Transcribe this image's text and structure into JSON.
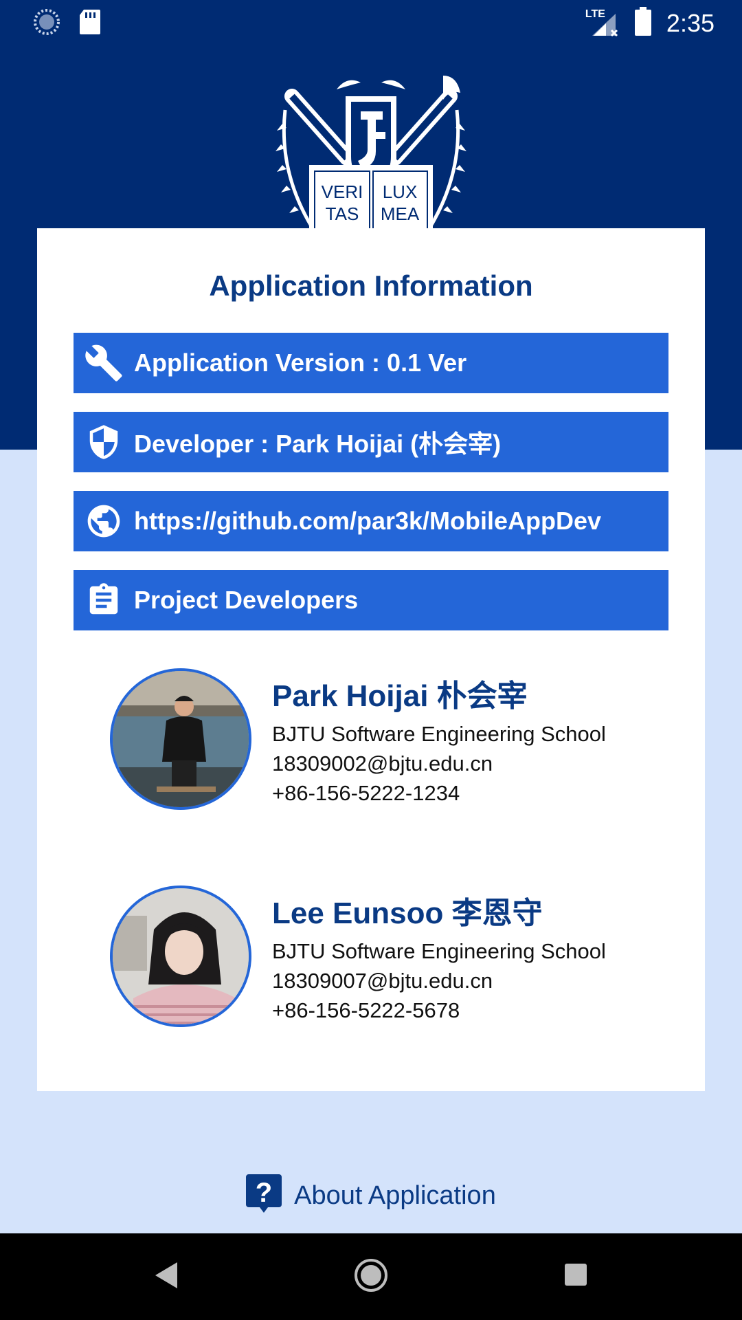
{
  "status_bar": {
    "time": "2:35",
    "network": "LTE"
  },
  "logo": {
    "motto_line1_left": "VERI",
    "motto_line1_right": "LUX",
    "motto_line2_left": "TAS",
    "motto_line2_right": "MEA"
  },
  "card": {
    "title": "Application Information",
    "buttons": [
      {
        "label": "Application Version : 0.1 Ver",
        "icon": "wrench-icon"
      },
      {
        "label": "Developer : Park Hoijai (朴会宰)",
        "icon": "shield-icon"
      },
      {
        "label": "https://github.com/par3k/MobileAppDev",
        "icon": "globe-icon"
      },
      {
        "label": "Project Developers",
        "icon": "clipboard-icon"
      }
    ],
    "developers": [
      {
        "name": "Park Hoijai 朴会宰",
        "school": "BJTU Software Engineering School",
        "email": "18309002@bjtu.edu.cn",
        "phone": "+86-156-5222-1234"
      },
      {
        "name": "Lee Eunsoo 李恩守",
        "school": "BJTU Software Engineering School",
        "email": "18309007@bjtu.edu.cn",
        "phone": "+86-156-5222-5678"
      }
    ]
  },
  "about": {
    "label": "About Application",
    "icon": "help-icon"
  },
  "colors": {
    "header_bg": "#002b73",
    "page_bg": "#d4e3fb",
    "button_bg": "#2466d8",
    "title_text": "#0a3a84"
  }
}
